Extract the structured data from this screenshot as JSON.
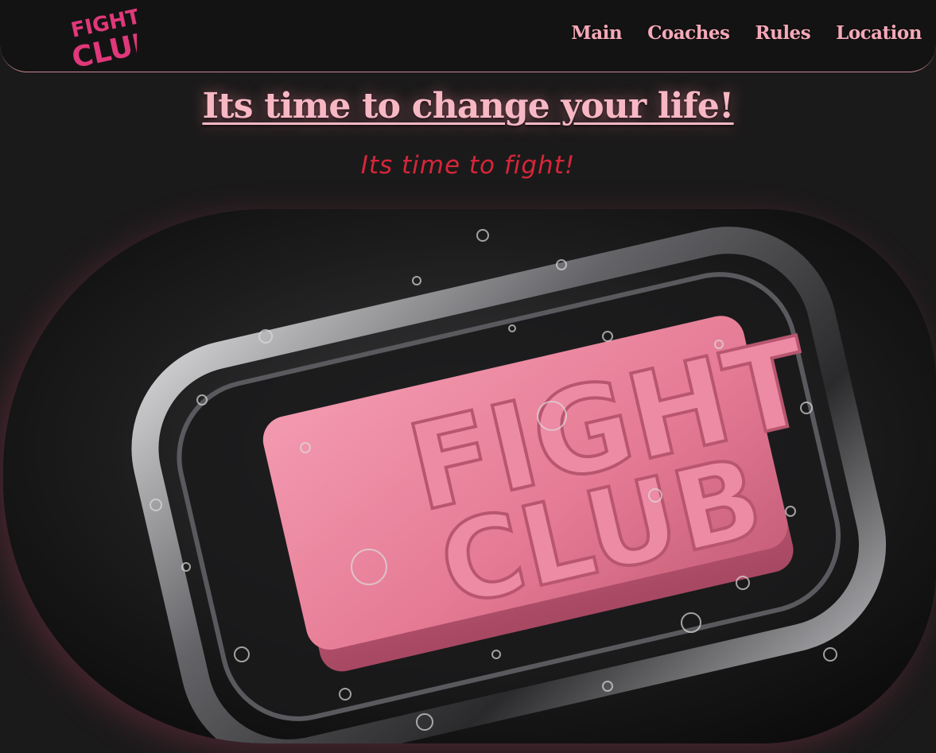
{
  "header": {
    "logo_text_line1": "FIGHT",
    "logo_text_line2": "CLUB",
    "nav": [
      {
        "label": "Main"
      },
      {
        "label": "Coaches"
      },
      {
        "label": "Rules"
      },
      {
        "label": "Location"
      }
    ]
  },
  "hero": {
    "headline": "Its time to change your life!",
    "subheadline": "Its time to fight!",
    "image_text_line1": "FIGHT",
    "image_text_line2": "CLUB"
  },
  "colors": {
    "background": "#1b1a1a",
    "accent_pink": "#f5a9b8",
    "accent_red": "#d6263a",
    "soap_pink": "#e57a94"
  }
}
